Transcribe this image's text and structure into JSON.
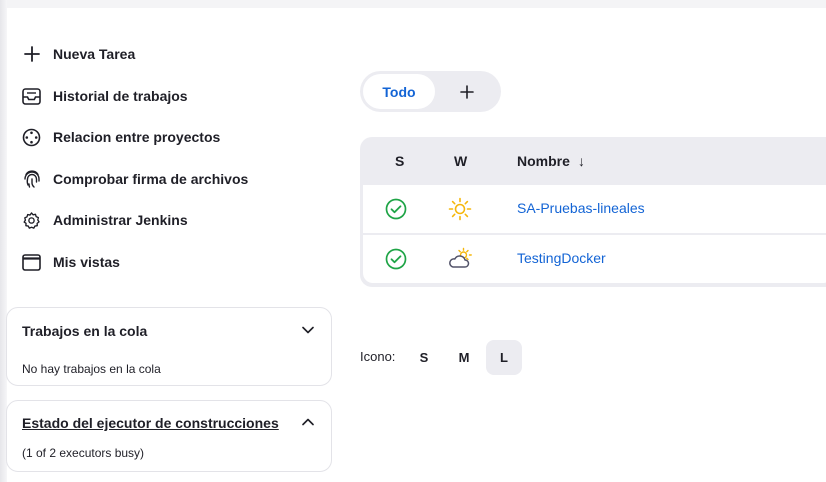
{
  "sidebar": {
    "items": [
      {
        "label": "Nueva Tarea",
        "icon": "plus-icon"
      },
      {
        "label": "Historial de trabajos",
        "icon": "inbox-icon"
      },
      {
        "label": "Relacion entre proyectos",
        "icon": "relationship-icon"
      },
      {
        "label": "Comprobar firma de archivos",
        "icon": "fingerprint-icon"
      },
      {
        "label": "Administrar Jenkins",
        "icon": "gear-icon"
      },
      {
        "label": "Mis vistas",
        "icon": "window-icon"
      }
    ]
  },
  "queue_panel": {
    "title": "Trabajos en la cola",
    "body": "No hay trabajos en la cola"
  },
  "executor_panel": {
    "title": "Estado del ejecutor de construcciones",
    "body": "(1 of 2 executors busy)"
  },
  "view_tabs": {
    "active": "Todo",
    "add_icon": "plus-icon"
  },
  "jobs_table": {
    "headers": {
      "status": "S",
      "weather": "W",
      "name": "Nombre",
      "sort": "↓"
    },
    "rows": [
      {
        "name": "SA-Pruebas-lineales",
        "status_icon": "success-check-icon",
        "weather_icon": "sunny-icon"
      },
      {
        "name": "TestingDocker",
        "status_icon": "success-check-icon",
        "weather_icon": "partly-cloudy-icon"
      }
    ]
  },
  "icon_size": {
    "label": "Icono:",
    "options": [
      "S",
      "M",
      "L"
    ],
    "selected": "L"
  },
  "colors": {
    "link": "#1364d5",
    "success": "#1ea446",
    "sun": "#f5b70b",
    "panel_bg": "#ececf1"
  }
}
